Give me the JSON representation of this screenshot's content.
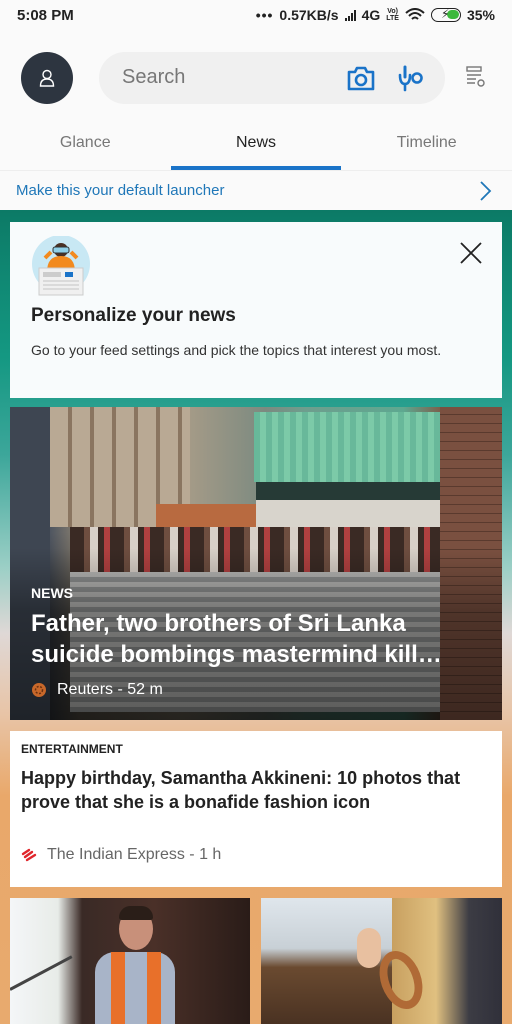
{
  "status_bar": {
    "time": "5:08 PM",
    "dots": "•••",
    "network_speed": "0.57KB/s",
    "network_type": "4G",
    "volte_label_top": "Vo)",
    "volte_label_bottom": "LTE",
    "battery_percent": "35%",
    "battery_charging": true
  },
  "header": {
    "avatar_icon": "person-icon",
    "search": {
      "placeholder": "Search",
      "value": "",
      "camera_icon": "camera-icon",
      "voice_icon": "microphone-icon"
    },
    "feed_settings_icon": "feed-settings-icon"
  },
  "tabs": [
    {
      "label": "Glance",
      "active": false
    },
    {
      "label": "News",
      "active": true
    },
    {
      "label": "Timeline",
      "active": false
    }
  ],
  "launcher_banner": {
    "text": "Make this your default launcher",
    "icon": "chevron-right-icon"
  },
  "colors": {
    "accent": "#1a73c8",
    "link": "#1f77b8",
    "avatar_bg": "#2d3540",
    "indian_express_red": "#e0252b"
  },
  "personalize_card": {
    "illustration": "binoculars-newspaper-illustration",
    "title": "Personalize your news",
    "description": "Go to your feed settings and pick the topics that interest you most.",
    "close_icon": "close-icon"
  },
  "articles": [
    {
      "category": "NEWS",
      "headline": "Father, two brothers of Sri Lanka suicide bombings mastermind kill…",
      "source": "Reuters - 52 m",
      "source_icon": "reuters-logo-icon"
    },
    {
      "category": "ENTERTAINMENT",
      "headline": "Happy birthday, Samantha Akkineni: 10 photos that prove that she is a bonafide fashion icon",
      "source": "The Indian Express - 1 h",
      "source_icon": "indian-express-logo-icon"
    }
  ],
  "image_cards": [
    {
      "image": "man-in-orange-scarf-photo"
    },
    {
      "image": "woman-holding-pastry-photo"
    }
  ]
}
